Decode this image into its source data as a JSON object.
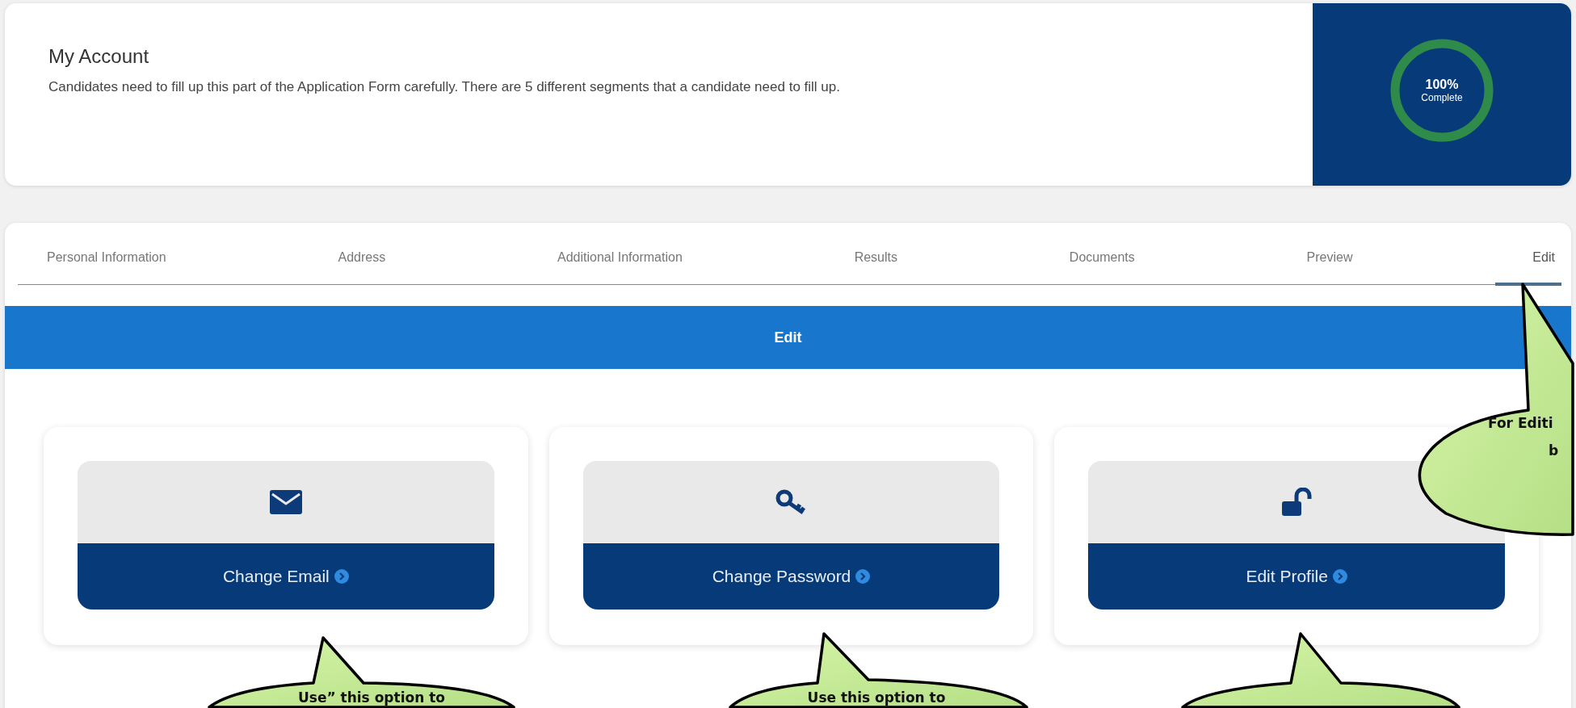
{
  "account": {
    "title": "My Account",
    "description": "Candidates need to fill up this part of the Application Form carefully. There are 5 different segments that a candidate need to fill up.",
    "progress": {
      "level": 1,
      "value": "100%",
      "label": "Complete"
    }
  },
  "tabs": [
    {
      "label": "Personal Information",
      "selected": false
    },
    {
      "label": "Address",
      "selected": false
    },
    {
      "label": "Additional Information",
      "selected": false
    },
    {
      "label": "Results",
      "selected": false
    },
    {
      "label": "Documents",
      "selected": false
    },
    {
      "label": "Preview",
      "selected": false
    },
    {
      "label": "Edit",
      "selected": true
    }
  ],
  "section_title": "Edit",
  "options": [
    {
      "kind": "email",
      "label": "Change Email"
    },
    {
      "kind": "password",
      "label": "Change Password"
    },
    {
      "kind": "profile",
      "label": "Edit Profile"
    }
  ],
  "callouts": [
    {
      "kind": "right",
      "lines": [
        "For Editi",
        "b"
      ]
    },
    {
      "kind": "bottom1",
      "lines": [
        "Use” this option to"
      ]
    },
    {
      "kind": "bottom2",
      "lines": [
        "Use this option to"
      ]
    },
    {
      "kind": "bottom3"
    }
  ]
}
